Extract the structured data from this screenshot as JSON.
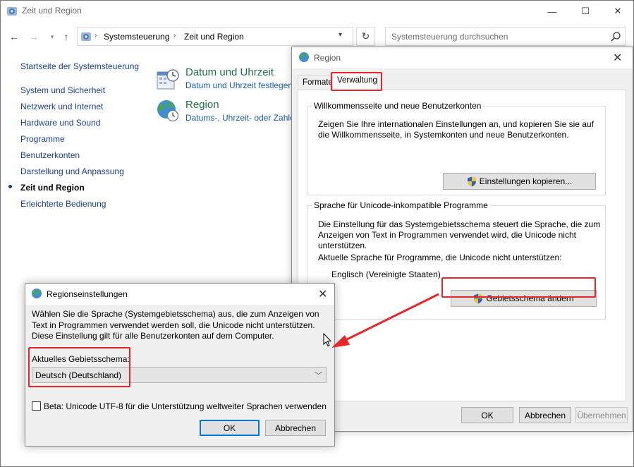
{
  "main_window": {
    "title": "Zeit und Region",
    "controls": {
      "minimize": "—",
      "maximize": "☐",
      "close": "✕"
    }
  },
  "address": {
    "crumbs": [
      "Systemsteuerung",
      "Zeit und Region"
    ],
    "search_placeholder": "Systemsteuerung durchsuchen"
  },
  "sidebar": {
    "items": [
      {
        "label": "Startseite der Systemsteuerung"
      },
      {
        "label": "System und Sicherheit"
      },
      {
        "label": "Netzwerk und Internet"
      },
      {
        "label": "Hardware und Sound"
      },
      {
        "label": "Programme"
      },
      {
        "label": "Benutzerkonten"
      },
      {
        "label": "Darstellung und Anpassung"
      },
      {
        "label": "Zeit und Region"
      },
      {
        "label": "Erleichterte Bedienung"
      }
    ]
  },
  "categories": [
    {
      "title": "Datum und Uhrzeit",
      "link": "Datum und Uhrzeit festlegen"
    },
    {
      "title": "Region",
      "link": "Datums-, Uhrzeit- oder Zahlen"
    }
  ],
  "region_dialog": {
    "title": "Region",
    "tabs": [
      "Formate",
      "Verwaltung"
    ],
    "welcome_group": {
      "legend": "Willkommensseite und neue Benutzerkonten",
      "text_lines": [
        "Zeigen Sie Ihre internationalen Einstellungen an, und kopieren Sie sie auf",
        "die Willkommensseite, in Systemkonten und neue Benutzerkonten."
      ],
      "button": "Einstellungen kopieren..."
    },
    "unicode_group": {
      "legend": "Sprache für Unicode-inkompatible Programme",
      "text_lines": [
        "Die Einstellung für das Systemgebietsschema steuert die Sprache, die zum",
        "Anzeigen von Text in Programmen verwendet wird, die Unicode nicht",
        "unterstützen."
      ],
      "current_label": "Aktuelle Sprache für Programme, die Unicode nicht unterstützen:",
      "current_value": "Englisch (Vereinigte Staaten)",
      "button": "Gebietsschema ändern"
    },
    "buttons": {
      "ok": "OK",
      "cancel": "Abbrechen",
      "apply": "Übernehmen"
    }
  },
  "region_settings_dialog": {
    "title": "Regionseinstellungen",
    "description": "Wählen Sie die Sprache (Systemgebietsschema) aus, die zum Anzeigen von Text in Programmen verwendet werden soll, die Unicode nicht unterstützen. Diese Einstellung gilt für alle Benutzerkonten auf dem Computer.",
    "current_locale_label": "Aktuelles Gebietsschema:",
    "current_locale_value": "Deutsch (Deutschland)",
    "beta_checkbox_label": "Beta: Unicode UTF-8 für die Unterstützung weltweiter Sprachen verwenden",
    "beta_checked": false,
    "buttons": {
      "ok": "OK",
      "cancel": "Abbrechen"
    }
  },
  "colors": {
    "highlight_red": "#e8272b",
    "link_blue": "#1a3e8c",
    "category_green": "#1e7145",
    "dialog_bg": "#f0f0f0"
  },
  "icons": [
    "control-panel-icon",
    "back-arrow-icon",
    "forward-arrow-icon",
    "up-arrow-icon",
    "refresh-icon",
    "search-icon",
    "calendar-clock-icon",
    "globe-clock-icon",
    "globe-icon",
    "uac-shield-icon",
    "close-icon",
    "chevron-down-icon"
  ]
}
